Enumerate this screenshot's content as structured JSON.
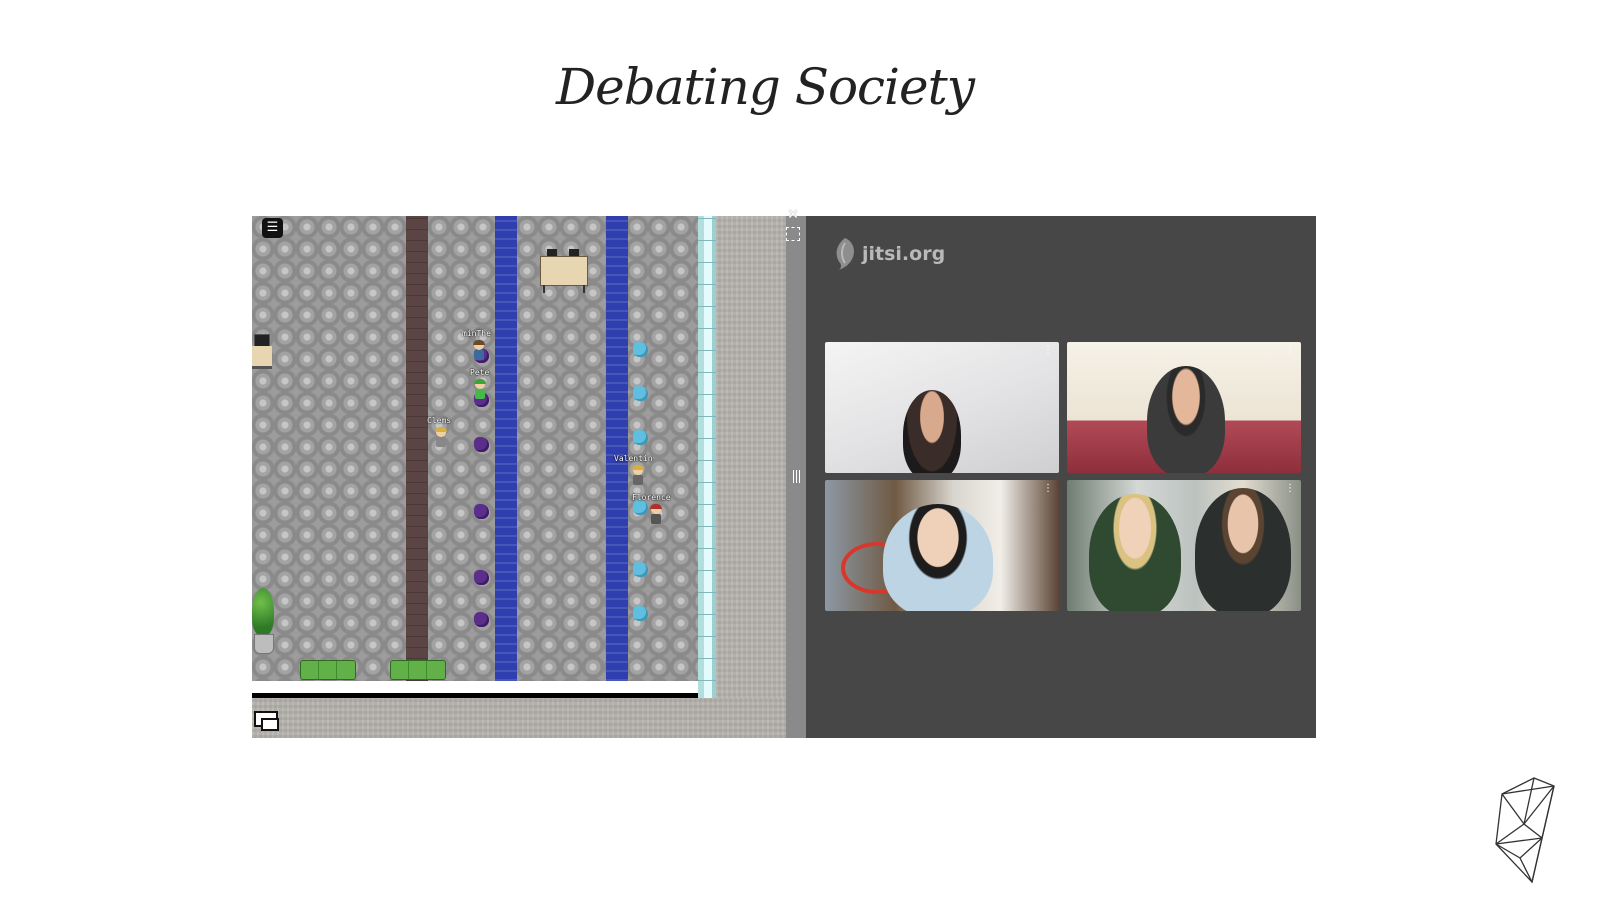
{
  "page": {
    "title": "Debating Society"
  },
  "game": {
    "menu_icon": "hamburger-menu-icon",
    "chat_icon": "chat-bubbles-icon",
    "players": [
      {
        "name": "minThe"
      },
      {
        "name": "Pete"
      },
      {
        "name": "Clems"
      },
      {
        "name": "Valentin"
      },
      {
        "name": "Florence"
      }
    ]
  },
  "panel": {
    "close_icon": "close-icon",
    "fullscreen_icon": "fullscreen-icon",
    "resize_icon": "resize-grip-icon"
  },
  "jitsi": {
    "logo_text": "jitsi.org",
    "tile_menu_icon": "more-vertical-icon",
    "participant_count": 4
  },
  "colors": {
    "jitsi_bg": "#474747",
    "water": "#2f3fb0",
    "wood": "#5b4544"
  },
  "footer": {
    "logo_icon": "polyhedron-logo-icon"
  }
}
